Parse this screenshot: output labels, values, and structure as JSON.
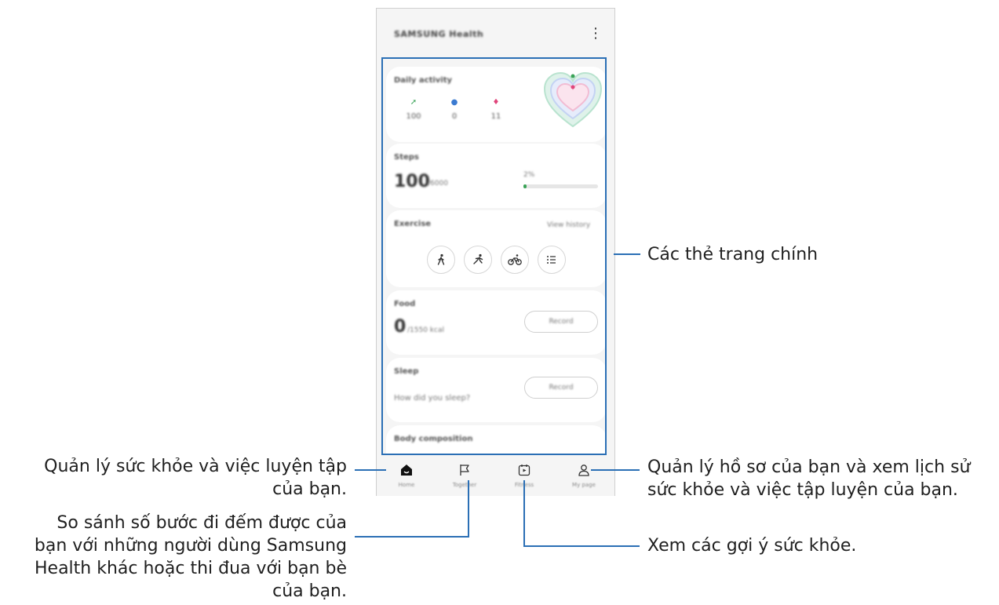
{
  "app": {
    "title": "SAMSUNG Health",
    "more_icon": "more-vertical-icon"
  },
  "cards": {
    "daily_activity": {
      "title": "Daily activity",
      "stats": [
        {
          "icon": "steps-icon",
          "value": "100",
          "color": "#3aa357"
        },
        {
          "icon": "timer-icon",
          "value": "0",
          "color": "#3b7bd1"
        },
        {
          "icon": "flame-icon",
          "value": "11",
          "color": "#e0457b"
        }
      ]
    },
    "steps": {
      "title": "Steps",
      "value": "100",
      "goal": "/6000",
      "progress_label": "2%",
      "progress_fraction": 0.02
    },
    "exercise": {
      "title": "Exercise",
      "link": "View history",
      "buttons": [
        "walking-icon",
        "running-icon",
        "cycling-icon",
        "list-icon"
      ]
    },
    "food": {
      "title": "Food",
      "value": "0",
      "goal": "/1550 kcal",
      "button": "Record"
    },
    "sleep": {
      "title": "Sleep",
      "prompt": "How did you sleep?",
      "button": "Record"
    },
    "body": {
      "title": "Body composition"
    }
  },
  "nav": [
    {
      "label": "Home",
      "icon": "home-icon"
    },
    {
      "label": "Together",
      "icon": "flag-icon"
    },
    {
      "label": "Fitness",
      "icon": "play-calendar-icon"
    },
    {
      "label": "My page",
      "icon": "person-icon"
    }
  ],
  "callouts": {
    "cards": "Các thẻ trang chính",
    "home_line1": "Quản lý sức khỏe và việc luyện tập",
    "home_line2": "của bạn.",
    "together_line1": "So sánh số bước đi đếm được của",
    "together_line2": "bạn với những người dùng Samsung",
    "together_line3": "Health khác hoặc thi đua với bạn bè",
    "together_line4": "của bạn.",
    "fitness": "Xem các gợi ý sức khỏe.",
    "mypage_line1": "Quản lý hồ sơ của bạn và xem lịch sử",
    "mypage_line2": "sức khỏe và việc tập luyện của bạn."
  }
}
